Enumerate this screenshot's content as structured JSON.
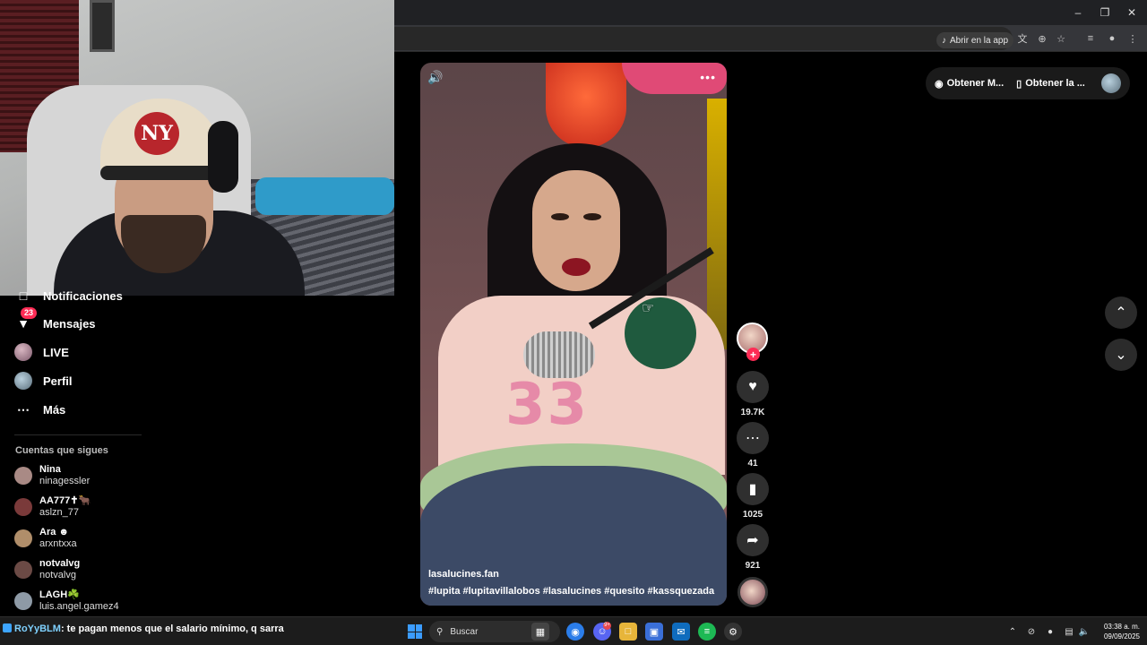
{
  "browser": {
    "open_in_app_label": "Abrir en la app"
  },
  "sidebar": {
    "items": [
      {
        "label": "Notificaciones",
        "icon": "inbox-icon"
      },
      {
        "label": "Mensajes",
        "icon": "send-icon",
        "badge": "23"
      },
      {
        "label": "LIVE",
        "icon": "live-avatar"
      },
      {
        "label": "Perfil",
        "icon": "profile-avatar"
      },
      {
        "label": "Más",
        "icon": "more-icon"
      }
    ],
    "following_title": "Cuentas que sigues",
    "following": [
      {
        "name": "Nina",
        "handle": "ninagessler",
        "color": "#a98a85"
      },
      {
        "name": "AA777✝🐂",
        "handle": "aslzn_77",
        "color": "#7a3a3a"
      },
      {
        "name": "Ara ☻",
        "handle": "arxntxxa",
        "color": "#b08e6a"
      },
      {
        "name": "notvalvg",
        "handle": "notvalvg",
        "color": "#6b4a45"
      },
      {
        "name": "LAGH☘️",
        "handle": "luis.angel.gamez4",
        "color": "#8e9aa6"
      }
    ]
  },
  "video": {
    "author": "lasalucines.fan",
    "hashtags": "#lupita  #lupitavillalobos  #lasalucines  #quesito  #kassquezada",
    "jersey_number": "33"
  },
  "actions": {
    "likes": "19.7K",
    "comments": "41",
    "saves": "1025",
    "shares": "921"
  },
  "get_bar": {
    "item1": "Obtener M...",
    "item2": "Obtener la ..."
  },
  "taskbar": {
    "chat_user": "RoYyBLM",
    "chat_message": ": te pagan menos que el salario mínimo, q sarra",
    "search_label": "Buscar",
    "discord_badge": "9+",
    "time": "03:38 a. m.",
    "date": "09/09/2025"
  },
  "colors": {
    "accent": "#fe2c55",
    "windows_blue": "#3b9cff"
  }
}
